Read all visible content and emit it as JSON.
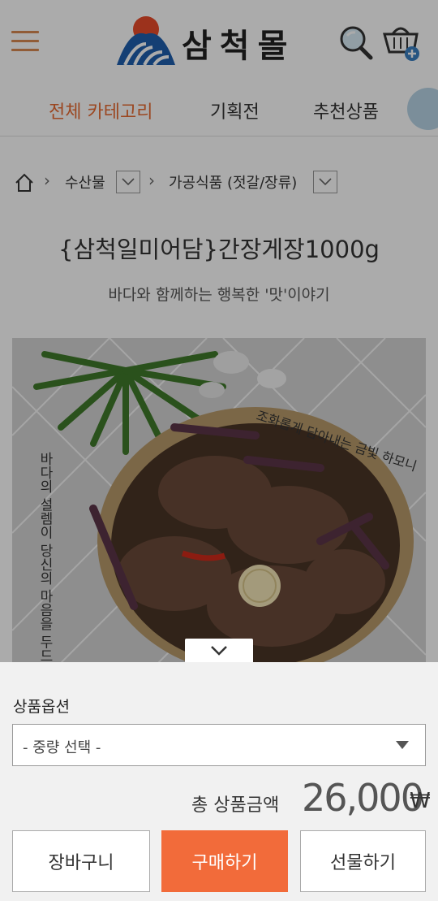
{
  "header": {
    "logo_text": "삼척몰",
    "icons": [
      "menu-icon",
      "search-icon",
      "cart-icon"
    ]
  },
  "nav": {
    "items": [
      {
        "label": "전체 카테고리",
        "active": true
      },
      {
        "label": "기획전",
        "active": false
      },
      {
        "label": "추천상품",
        "active": false
      }
    ]
  },
  "breadcrumb": {
    "home_icon": "home-icon",
    "level1": "수산물",
    "level2": "가공식품 (젓갈/장류)"
  },
  "product": {
    "title": "{삼척일미어담}간장게장1000g",
    "subtitle": "바다와 함께하는 행복한 '맛'이야기",
    "image_text_vertical": "바다의 설렘이 당신의 마음을 두드",
    "image_text_curved": "조화롭게 담아내는 금빛 하모니"
  },
  "options": {
    "label": "상품옵션",
    "select_value": "- 중량 선택 -"
  },
  "total": {
    "label": "총 상품금액",
    "value": "26,000",
    "unit": "₩"
  },
  "buttons": {
    "cart": "장바구니",
    "buy": "구매하기",
    "gift": "선물하기"
  },
  "colors": {
    "accent": "#f26b3a",
    "nav_active": "#e86a32",
    "hamburger": "#d98a52"
  }
}
